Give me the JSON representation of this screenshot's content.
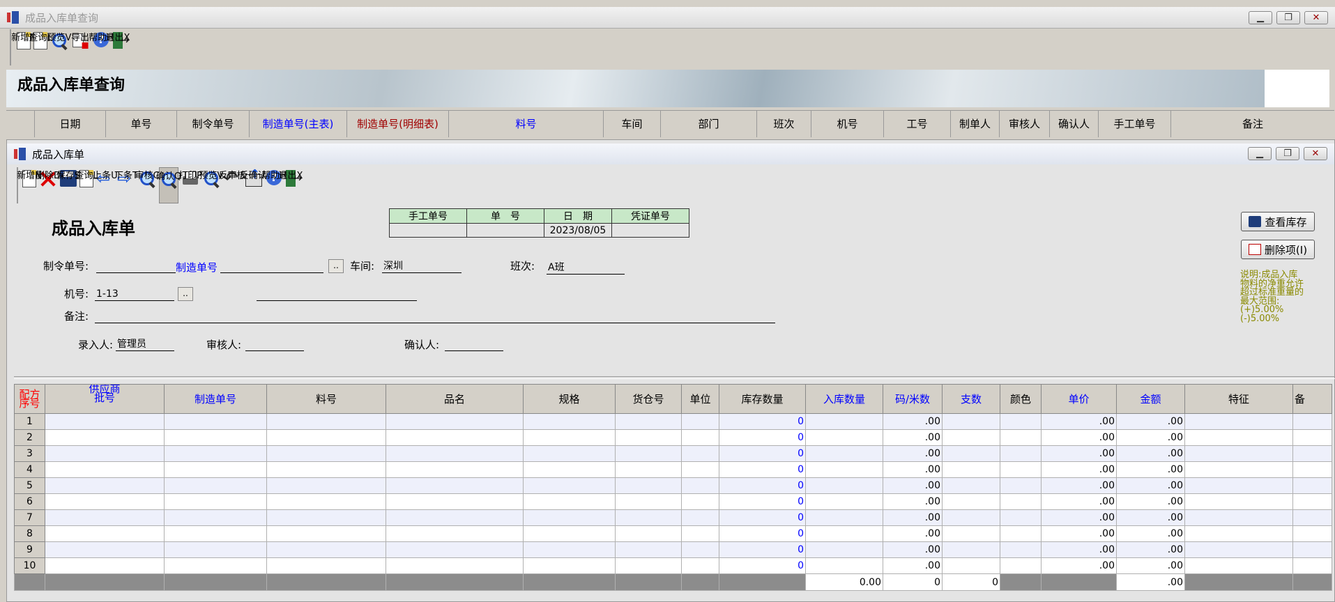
{
  "outer_window": {
    "title": "成品入库单查询"
  },
  "outer_toolbar": [
    {
      "label": "新增N",
      "icon": "new-doc-icon"
    },
    {
      "label": "查询L",
      "icon": "query-doc-icon"
    },
    {
      "label": "预览V",
      "icon": "preview-icon"
    },
    {
      "label": "导出",
      "icon": "export-icon"
    },
    {
      "label": "帮助H",
      "icon": "help-icon"
    },
    {
      "label": "退出X",
      "icon": "exit-icon"
    }
  ],
  "banner_title": "成品入库单查询",
  "query_columns": [
    "日期",
    "单号",
    "制令单号",
    "制造单号(主表)",
    "制造单号(明细表)",
    "料号",
    "车间",
    "部门",
    "班次",
    "机号",
    "工号",
    "制单人",
    "审核人",
    "确认人",
    "手工单号",
    "备注"
  ],
  "inner_window": {
    "title": "成品入库单"
  },
  "inner_toolbar": [
    {
      "label": "新增N",
      "icon": "new-doc-icon"
    },
    {
      "label": "删除D",
      "icon": "delete-icon"
    },
    {
      "label": "保存S",
      "icon": "save-icon"
    },
    {
      "label": "查询L",
      "icon": "query-doc-icon"
    },
    {
      "label": "上条U",
      "icon": "arrow-left-icon"
    },
    {
      "label": "下条T",
      "icon": "arrow-right-icon"
    },
    {
      "label": "审核C",
      "icon": "audit-icon"
    },
    {
      "label": "确认Q",
      "icon": "confirm-icon"
    },
    {
      "label": "打印P",
      "icon": "print-icon"
    },
    {
      "label": "预览V",
      "icon": "preview-icon"
    },
    {
      "label": "反审核",
      "icon": "unaudit-icon"
    },
    {
      "label": "反确认",
      "icon": "unconfirm-icon"
    },
    {
      "label": "帮助H",
      "icon": "help-icon"
    },
    {
      "label": "退出X",
      "icon": "exit-icon"
    }
  ],
  "form": {
    "title": "成品入库单",
    "header_table": {
      "headers": [
        "手工单号",
        "单　号",
        "日　期",
        "凭证单号"
      ],
      "values": [
        "",
        "",
        "2023/08/05",
        ""
      ]
    },
    "zhiling_label": "制令单号:",
    "zhiling_value": "",
    "zhizao_label": "制造单号",
    "zhizao_value": "",
    "chejian_label": "车间:",
    "chejian_value": "深圳",
    "banci_label": "班次:",
    "banci_value": "A班",
    "jihao_label": "机号:",
    "jihao_value": "1-13",
    "beizhu_label": "备注:",
    "beizhu_value": "",
    "luru_label": "录入人:",
    "luru_value": "管理员",
    "shenhe_label": "审核人:",
    "shenhe_value": "",
    "queren_label": "确认人:",
    "queren_value": "",
    "browse_btn": ".."
  },
  "side_buttons": {
    "view_stock": "查看库存",
    "delete_item": "删除项(I)"
  },
  "note": [
    "说明:成品入库",
    "物料的净重允许",
    "超过标准重量的",
    "最大范围:",
    "(+)5.00%",
    "(-)5.00%"
  ],
  "grid": {
    "headers": [
      "配方\n序号",
      "供应商\n批号",
      "制造单号",
      "料号",
      "品名",
      "规格",
      "货仓号",
      "单位",
      "库存数量",
      "入库数量",
      "码/米数",
      "支数",
      "颜色",
      "单价",
      "金额",
      "特征",
      "备"
    ],
    "rows": [
      {
        "no": "1",
        "stock": "0",
        "ma": ".00",
        "price": ".00",
        "amount": ".00"
      },
      {
        "no": "2",
        "stock": "0",
        "ma": ".00",
        "price": ".00",
        "amount": ".00"
      },
      {
        "no": "3",
        "stock": "0",
        "ma": ".00",
        "price": ".00",
        "amount": ".00"
      },
      {
        "no": "4",
        "stock": "0",
        "ma": ".00",
        "price": ".00",
        "amount": ".00"
      },
      {
        "no": "5",
        "stock": "0",
        "ma": ".00",
        "price": ".00",
        "amount": ".00"
      },
      {
        "no": "6",
        "stock": "0",
        "ma": ".00",
        "price": ".00",
        "amount": ".00"
      },
      {
        "no": "7",
        "stock": "0",
        "ma": ".00",
        "price": ".00",
        "amount": ".00"
      },
      {
        "no": "8",
        "stock": "0",
        "ma": ".00",
        "price": ".00",
        "amount": ".00"
      },
      {
        "no": "9",
        "stock": "0",
        "ma": ".00",
        "price": ".00",
        "amount": ".00"
      },
      {
        "no": "10",
        "stock": "0",
        "ma": ".00",
        "price": ".00",
        "amount": ".00"
      }
    ],
    "footer": {
      "qty": "0.00",
      "ma": "0",
      "zhi": "0",
      "amount": ".00"
    }
  },
  "colors": {
    "header_blue": "#0000ff",
    "header_red": "#ff0000",
    "header_darkred": "#a00000",
    "note": "#8a8a00"
  }
}
